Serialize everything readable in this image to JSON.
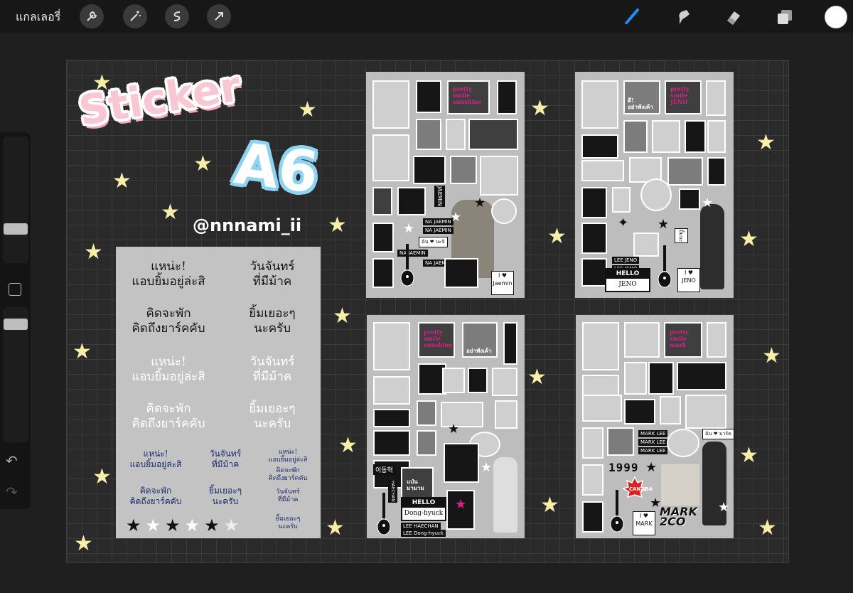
{
  "toolbar": {
    "gallery_label": "แกลเลอรี่",
    "left_tools": [
      "wrench-icon",
      "magic-wand-icon",
      "selection-icon",
      "transform-arrow-icon"
    ],
    "right_tools": [
      "brush-icon",
      "smudge-icon",
      "eraser-icon",
      "layers-icon"
    ],
    "active_color": "#ffffff",
    "accent": "#1e90ff"
  },
  "artwork": {
    "title_line1": "Sticker",
    "title_line2": "A6",
    "handle": "@nnnami_ii",
    "text_sheet": {
      "big_black": [
        "แหน่ะ!\nแอบยิ้มอยู่ล่ะสิ",
        "วันจันทร์\nที่มีม้าค",
        "คิดจะพัก\nคิดถึงยาร์คคับ",
        "ยิ้มเยอะๆ\nนะครับ"
      ],
      "big_white": [
        "แหน่ะ!\nแอบยิ้มอยู่ล่ะสิ",
        "วันจันทร์\nที่มีม้าค",
        "คิดจะพัก\nคิดถึงยาร์คคับ",
        "ยิ้มเยอะๆ\nนะครับ"
      ],
      "small": [
        "แหน่ะ!\nแอบยิ้มอยู่ล่ะสิ",
        "วันจันทร์\nที่มีม้าค",
        "คิดจะพัก\nคิดถึงยาร์คคับ",
        "ยิ้มเยอะๆ\nนะครับ"
      ],
      "xsmall": [
        "แหน่ะ!\nแอบยิ้มอยู่ล่ะสิ",
        "คิดจะพัก\nคิดถึงยาร์คคับ",
        "วันจันทร์\nที่มีม้าค",
        "ยิ้มเยอะๆ\nนะครับ"
      ]
    },
    "sheets": [
      {
        "name": "jaemin",
        "pink_text": "pretty\nsmile\nsunshine",
        "labels": [
          "NA JAEMIN",
          "NA JAEMIN",
          "NA JAEMIN",
          "NA JAEMIN"
        ],
        "heart_label": "ฉัน ❤ นะจิ",
        "vertical_label": "JAEMIN",
        "ilove_name": "Jaemin"
      },
      {
        "name": "jeno",
        "pink_text": "pretty\nsmile\nJENO",
        "bubble_text": "ดี!\nอย่าพังเค้า",
        "labels": [
          "LEE JENO",
          "LEE JENO"
        ],
        "hello_name": "JENO",
        "hello_text": "HELLO",
        "ilove_name": "JENO",
        "side_label": "ยิ้มนะ"
      },
      {
        "name": "haechan",
        "pink_text": "pretty\nsmile\nsunshine",
        "caption": "อย่าพังเค้า",
        "name_box": "이동혁",
        "thai_caption": "แป่น\nมามาม",
        "hello_text": "HELLO",
        "hello_name": "Dong-hyuck",
        "labels": [
          "LEE HAECHAN",
          "LEE Dong-hyuck"
        ],
        "vertical_label": "HAECHAN"
      },
      {
        "name": "mark",
        "pink_text": "pretty\nsmile\nmark",
        "labels": [
          "MARK LEE",
          "MARK LEE",
          "MARK LEE"
        ],
        "number": "1999",
        "tag": "ฉัน ❤ มาร์ค",
        "flag_text": "CANADA",
        "logo": "MARK\n2CO",
        "ilove_name": "MARK"
      }
    ]
  }
}
